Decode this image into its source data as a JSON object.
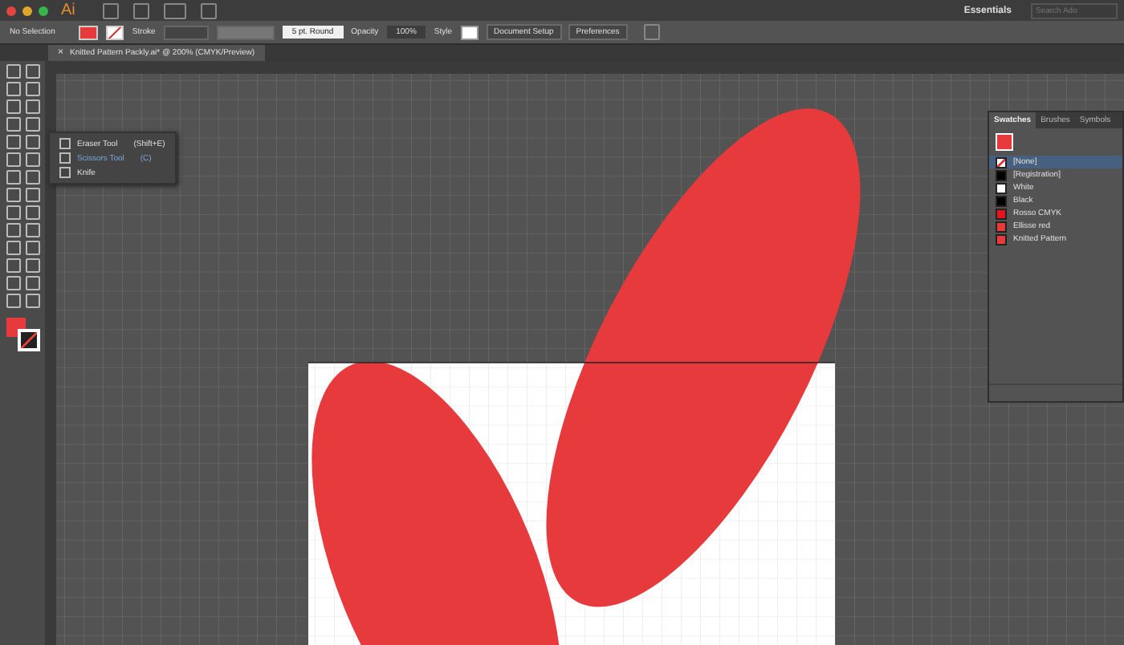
{
  "app": {
    "logo": "Ai",
    "workspace": "Essentials",
    "search": {
      "placeholder": "Search Ado"
    }
  },
  "control_bar": {
    "selection": "No Selection",
    "stroke_label": "Stroke",
    "brush": "5 pt. Round",
    "opacity_label": "Opacity",
    "opacity": "100%",
    "style_label": "Style",
    "buttons": [
      "Document Setup",
      "Preferences"
    ]
  },
  "document_tab": {
    "title": "Knitted Pattern Packly.ai* @ 200% (CMYK/Preview)",
    "close": "×"
  },
  "tool_flyout": {
    "items": [
      {
        "label": "Eraser Tool",
        "shortcut": "(Shift+E)",
        "selected": false
      },
      {
        "label": "Scissors Tool",
        "shortcut": "(C)",
        "selected": true
      },
      {
        "label": "Knife",
        "selected": false
      }
    ]
  },
  "swatches_panel": {
    "tabs": [
      {
        "label": "Swatches",
        "selected": true
      },
      {
        "label": "Brushes",
        "selected": false
      },
      {
        "label": "Symbols",
        "selected": false
      }
    ],
    "items": [
      {
        "name": "[None]",
        "kind": "none",
        "selected": true
      },
      {
        "name": "[Registration]",
        "kind": "solid",
        "color": "#000000",
        "selected": false
      },
      {
        "name": "White",
        "kind": "solid",
        "color": "#ffffff",
        "selected": false
      },
      {
        "name": "Black",
        "kind": "solid",
        "color": "#000000",
        "selected": false
      },
      {
        "name": "Rosso CMYK",
        "kind": "solid",
        "color": "#e4161c",
        "selected": false
      },
      {
        "name": "Ellisse red",
        "kind": "solid",
        "color": "#e63a3c",
        "selected": false
      },
      {
        "name": "Knitted Pattern",
        "kind": "pattern",
        "color": "#e63a3c",
        "selected": false
      }
    ]
  }
}
